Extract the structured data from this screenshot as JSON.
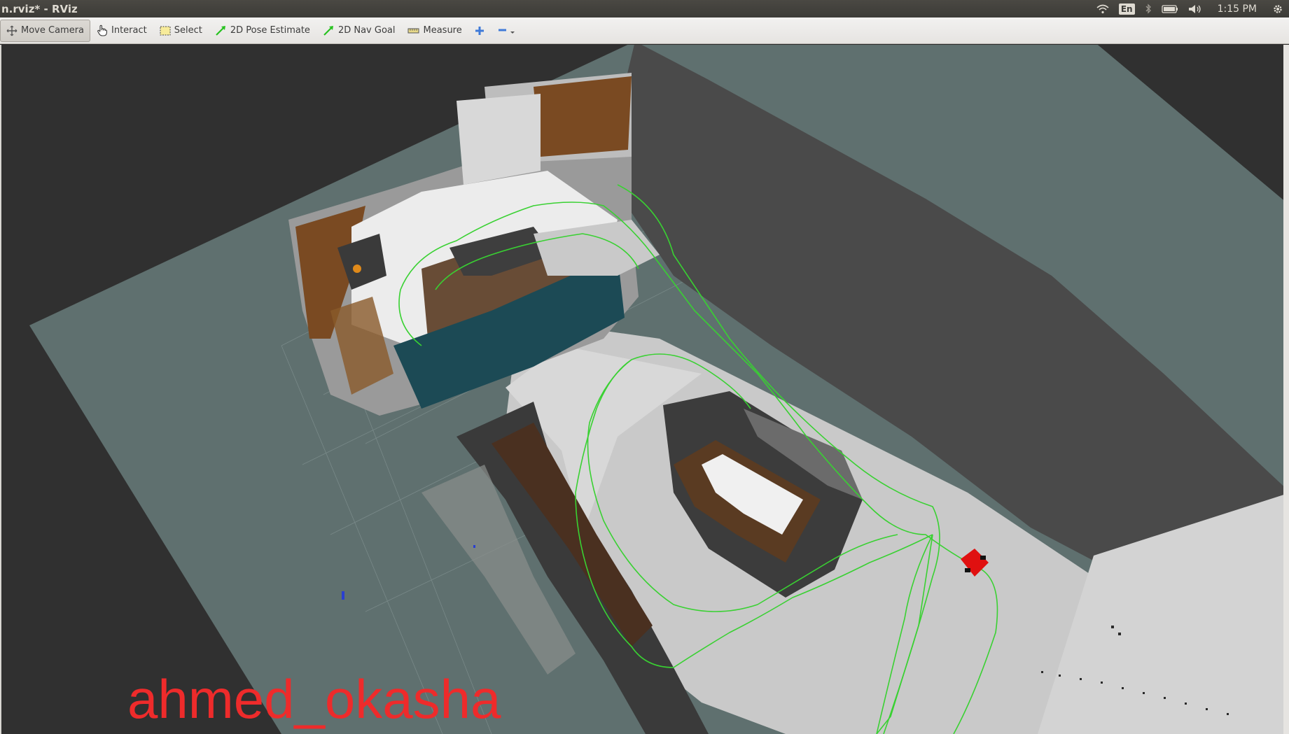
{
  "window": {
    "title": "n.rviz* - RViz"
  },
  "tray": {
    "language": "En",
    "time": "1:15 PM"
  },
  "toolbar": {
    "tools": [
      {
        "label": "Move Camera",
        "icon": "move-camera-icon",
        "active": true
      },
      {
        "label": "Interact",
        "icon": "hand-pointer-icon",
        "active": false
      },
      {
        "label": "Select",
        "icon": "select-box-icon",
        "active": false
      },
      {
        "label": "2D Pose Estimate",
        "icon": "green-arrow-icon",
        "active": false
      },
      {
        "label": "2D Nav Goal",
        "icon": "green-arrow-icon",
        "active": false
      },
      {
        "label": "Measure",
        "icon": "ruler-icon",
        "active": false
      }
    ],
    "add_tool_icon": "plus-icon",
    "remove_tool_icon": "minus-dropdown-icon"
  },
  "viewport": {
    "watermark": "ahmed_okasha",
    "colors": {
      "background": "#303030",
      "ground_plane": "#5f706f",
      "free_space": "#c9c9c9",
      "path": "#39d132",
      "robot": "#e01010",
      "wood": "#7a4a22"
    }
  }
}
